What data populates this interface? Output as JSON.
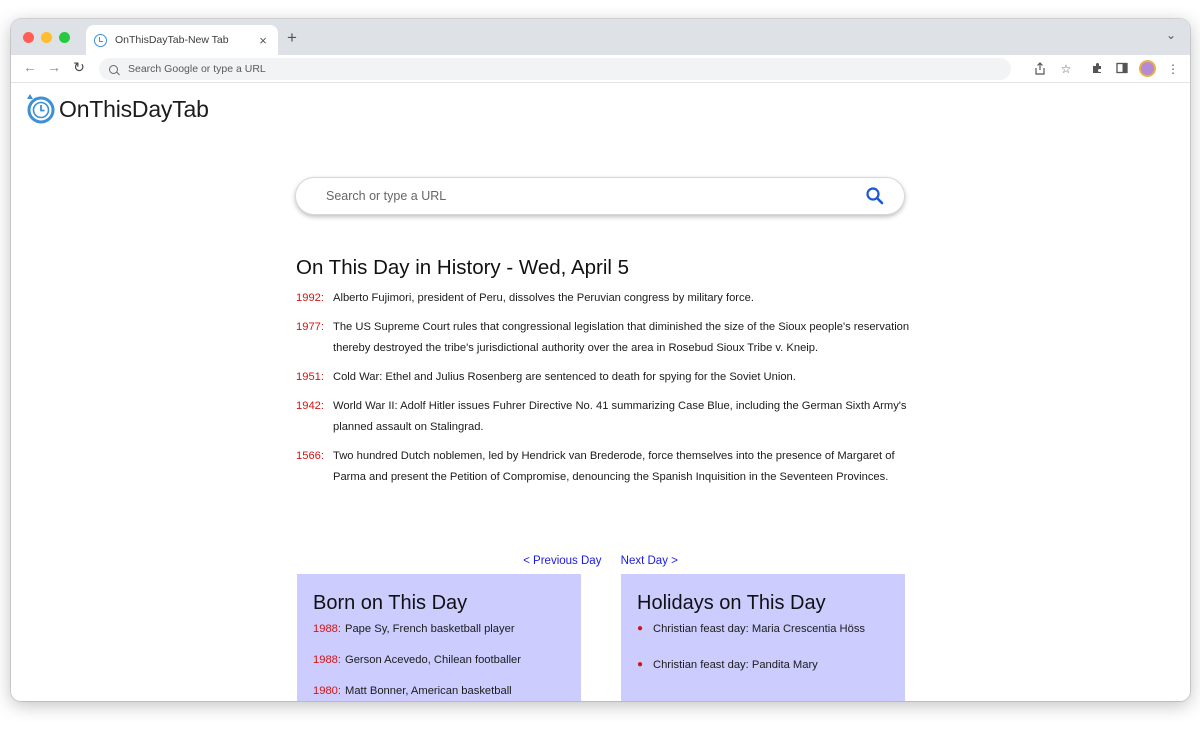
{
  "browser": {
    "tab_title": "OnThisDayTab-New Tab",
    "tab_close": "×",
    "new_tab": "+",
    "omnibox_placeholder": "Search Google or type a URL",
    "traffic_colors": [
      "#ff5f57",
      "#febc2e",
      "#28c840"
    ]
  },
  "logo": {
    "text": "OnThisDayTab",
    "accent": "#3d8fd6"
  },
  "search": {
    "placeholder": "Search or type a URL",
    "icon": "search-icon",
    "icon_color": "#1a56d6"
  },
  "history": {
    "title": "On This Day in History - Wed, April 5",
    "events": [
      {
        "year": "1992:",
        "text": "Alberto Fujimori, president of Peru, dissolves the Peruvian congress by military force."
      },
      {
        "year": "1977:",
        "text": "The US Supreme Court rules that congressional legislation that diminished the size of the Sioux people's reservation thereby destroyed the tribe's jurisdictional authority over the area in Rosebud Sioux Tribe v. Kneip."
      },
      {
        "year": "1951:",
        "text": "Cold War: Ethel and Julius Rosenberg are sentenced to death for spying for the Soviet Union."
      },
      {
        "year": "1942:",
        "text": "World War II: Adolf Hitler issues Fuhrer Directive No. 41 summarizing Case Blue, including the German Sixth Army's planned assault on Stalingrad."
      },
      {
        "year": "1566:",
        "text": "Two hundred Dutch noblemen, led by Hendrick van Brederode, force themselves into the presence of Margaret of Parma and present the Petition of Compromise, denouncing the Spanish Inquisition in the Seventeen Provinces."
      }
    ]
  },
  "nav": {
    "prev": "< Previous Day",
    "next": "Next Day >"
  },
  "born": {
    "title": "Born on This Day",
    "items": [
      {
        "year": "1988:",
        "text": "Pape Sy, French basketball player"
      },
      {
        "year": "1988:",
        "text": "Gerson Acevedo, Chilean footballer"
      },
      {
        "year": "1980:",
        "text": "Matt Bonner, American basketball"
      }
    ]
  },
  "holidays": {
    "title": "Holidays on This Day",
    "items": [
      {
        "text": "Christian feast day: Maria Crescentia Höss"
      },
      {
        "text": "Christian feast day: Pandita Mary"
      }
    ]
  },
  "colors": {
    "card_bg": "#ccccff",
    "year_red": "#d01616",
    "link_blue": "#1a1ae6"
  }
}
